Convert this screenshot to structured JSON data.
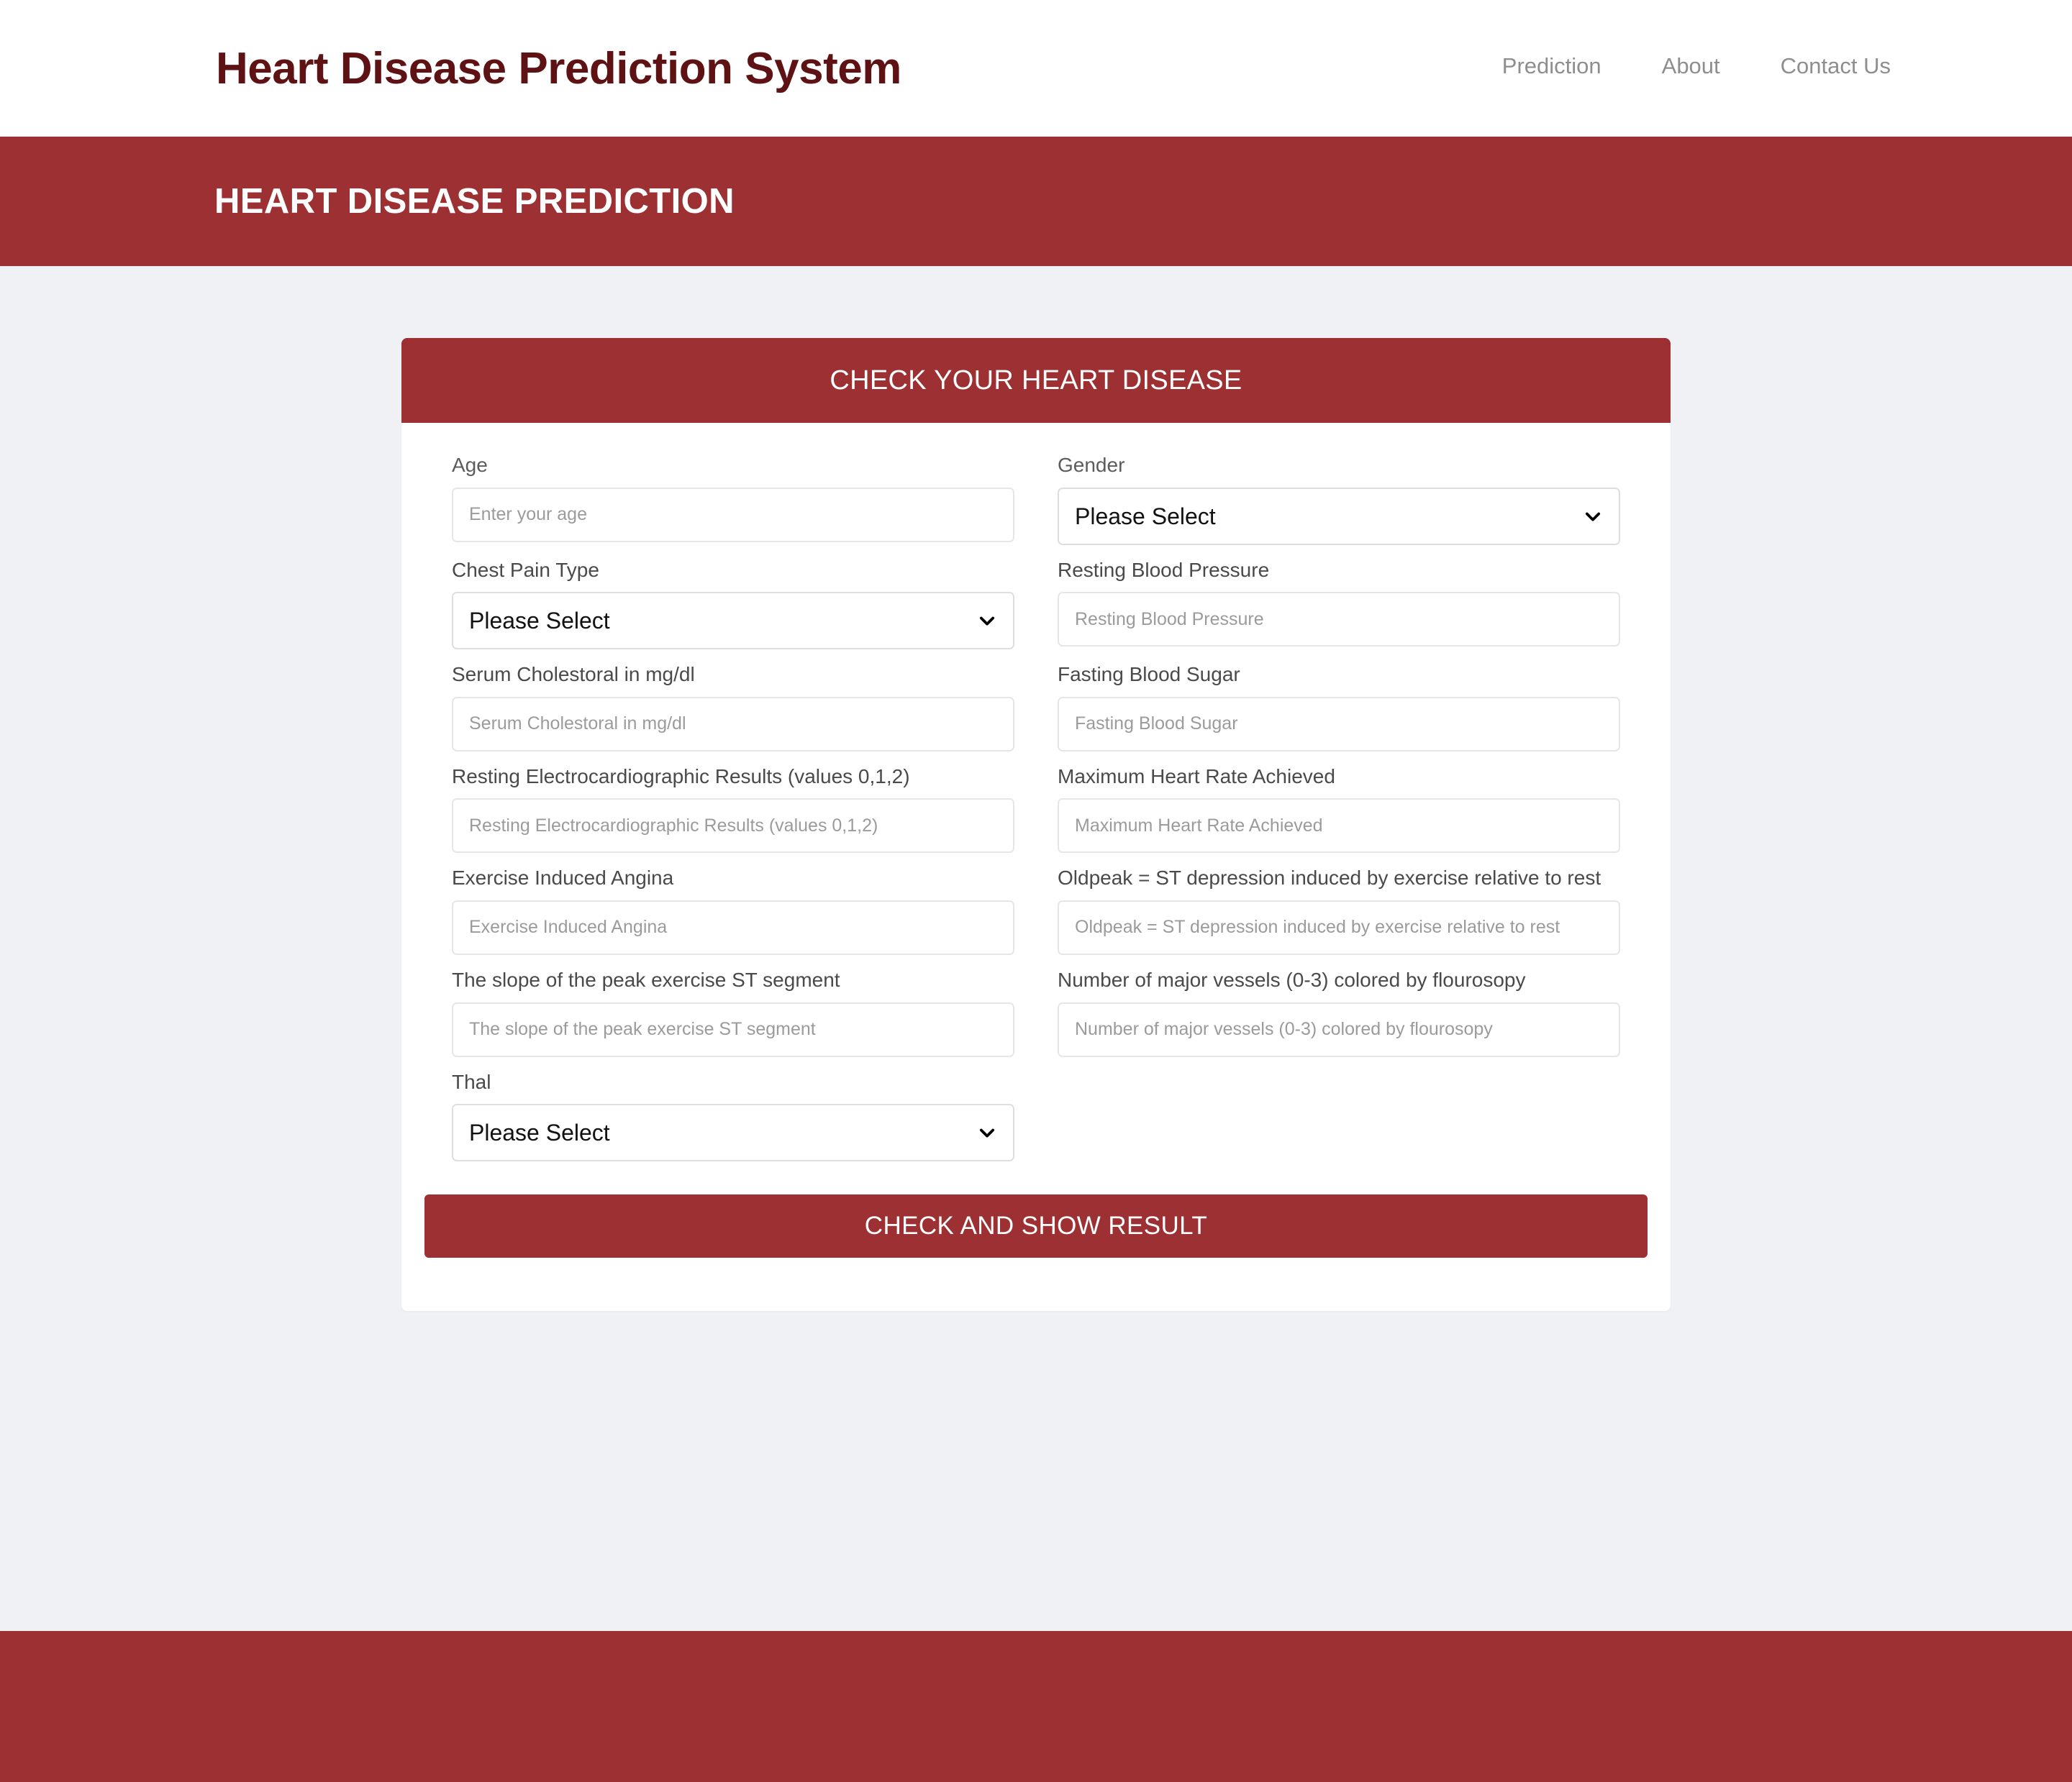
{
  "colors": {
    "brand_maroon": "#5E1214",
    "accent_red": "#9C3033",
    "page_bg": "#F0F1F5",
    "card_bg": "#FFFFFF",
    "label_gray": "#5C5C5C",
    "placeholder_gray": "#9B9B9B",
    "input_border": "#E4E6E9"
  },
  "navbar": {
    "brand": "Heart Disease Prediction System",
    "links": [
      {
        "label": "Prediction"
      },
      {
        "label": "About"
      },
      {
        "label": "Contact Us"
      }
    ]
  },
  "page_banner": {
    "title": "HEART DISEASE PREDICTION"
  },
  "card": {
    "header_title": "CHECK YOUR HEART DISEASE",
    "submit_label": "CHECK AND SHOW RESULT",
    "fields": [
      {
        "name": "age",
        "label": "Age",
        "control": "input",
        "placeholder": "Enter your age",
        "value": ""
      },
      {
        "name": "gender",
        "label": "Gender",
        "control": "select",
        "selected": "Please Select"
      },
      {
        "name": "chest-pain-type",
        "label": "Chest Pain Type",
        "control": "select",
        "selected": "Please Select"
      },
      {
        "name": "resting-blood-pressure",
        "label": "Resting Blood Pressure",
        "control": "input",
        "placeholder": "Resting Blood Pressure",
        "value": ""
      },
      {
        "name": "serum-cholestoral",
        "label": "Serum Cholestoral in mg/dl",
        "control": "input",
        "placeholder": "Serum Cholestoral in mg/dl",
        "value": ""
      },
      {
        "name": "fasting-blood-sugar",
        "label": "Fasting Blood Sugar",
        "control": "input",
        "placeholder": "Fasting Blood Sugar",
        "value": ""
      },
      {
        "name": "resting-ecg-results",
        "label": "Resting Electrocardiographic Results (values 0,1,2)",
        "control": "input",
        "placeholder": "Resting Electrocardiographic Results (values 0,1,2)",
        "value": ""
      },
      {
        "name": "maximum-heart-rate",
        "label": "Maximum Heart Rate Achieved",
        "control": "input",
        "placeholder": "Maximum Heart Rate Achieved",
        "value": ""
      },
      {
        "name": "exercise-induced-angina",
        "label": "Exercise Induced Angina",
        "control": "input",
        "placeholder": "Exercise Induced Angina",
        "value": ""
      },
      {
        "name": "oldpeak",
        "label": "Oldpeak = ST depression induced by exercise relative to rest",
        "control": "input",
        "placeholder": "Oldpeak = ST depression induced by exercise relative to rest",
        "value": ""
      },
      {
        "name": "st-slope",
        "label": "The slope of the peak exercise ST segment",
        "control": "input",
        "placeholder": "The slope of the peak exercise ST segment",
        "value": ""
      },
      {
        "name": "major-vessels",
        "label": "Number of major vessels (0-3) colored by flourosopy",
        "control": "input",
        "placeholder": "Number of major vessels (0-3) colored by flourosopy",
        "value": ""
      },
      {
        "name": "thal",
        "label": "Thal",
        "control": "select",
        "selected": "Please Select"
      }
    ]
  },
  "icons": {
    "chevron_down": "chevron-down-icon"
  }
}
